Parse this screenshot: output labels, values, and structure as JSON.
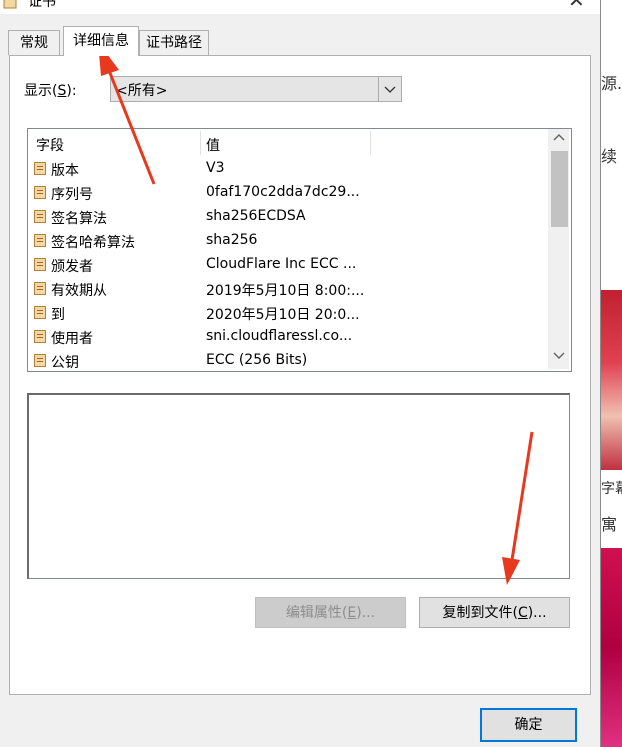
{
  "window": {
    "title": "证书"
  },
  "tabs": [
    {
      "label": "常规"
    },
    {
      "label": "详细信息"
    },
    {
      "label": "证书路径"
    }
  ],
  "show": {
    "label_pre": "显示(",
    "label_key": "S",
    "label_post": "):",
    "value": "<所有>"
  },
  "list": {
    "headers": {
      "field": "字段",
      "value": "值"
    },
    "rows": [
      {
        "field": "版本",
        "value": "V3"
      },
      {
        "field": "序列号",
        "value": "0faf170c2dda7dc29..."
      },
      {
        "field": "签名算法",
        "value": "sha256ECDSA"
      },
      {
        "field": "签名哈希算法",
        "value": "sha256"
      },
      {
        "field": "颁发者",
        "value": "CloudFlare Inc ECC ..."
      },
      {
        "field": "有效期从",
        "value": "2019年5月10日 8:00:..."
      },
      {
        "field": "到",
        "value": "2020年5月10日 20:0..."
      },
      {
        "field": "使用者",
        "value": "sni.cloudflaressl.co..."
      },
      {
        "field": "公钥",
        "value": "ECC (256 Bits)"
      }
    ]
  },
  "buttons": {
    "edit_pre": "编辑属性(",
    "edit_key": "E",
    "edit_post": ")...",
    "copy_pre": "复制到文件(",
    "copy_key": "C",
    "copy_post": ")...",
    "ok": "确定"
  },
  "background": {
    "t1": "源.",
    "t2": "续",
    "t3": "字幕",
    "t4": "寓"
  },
  "colors": {
    "arrow": "#e8391f",
    "accent": "#0078d7"
  }
}
